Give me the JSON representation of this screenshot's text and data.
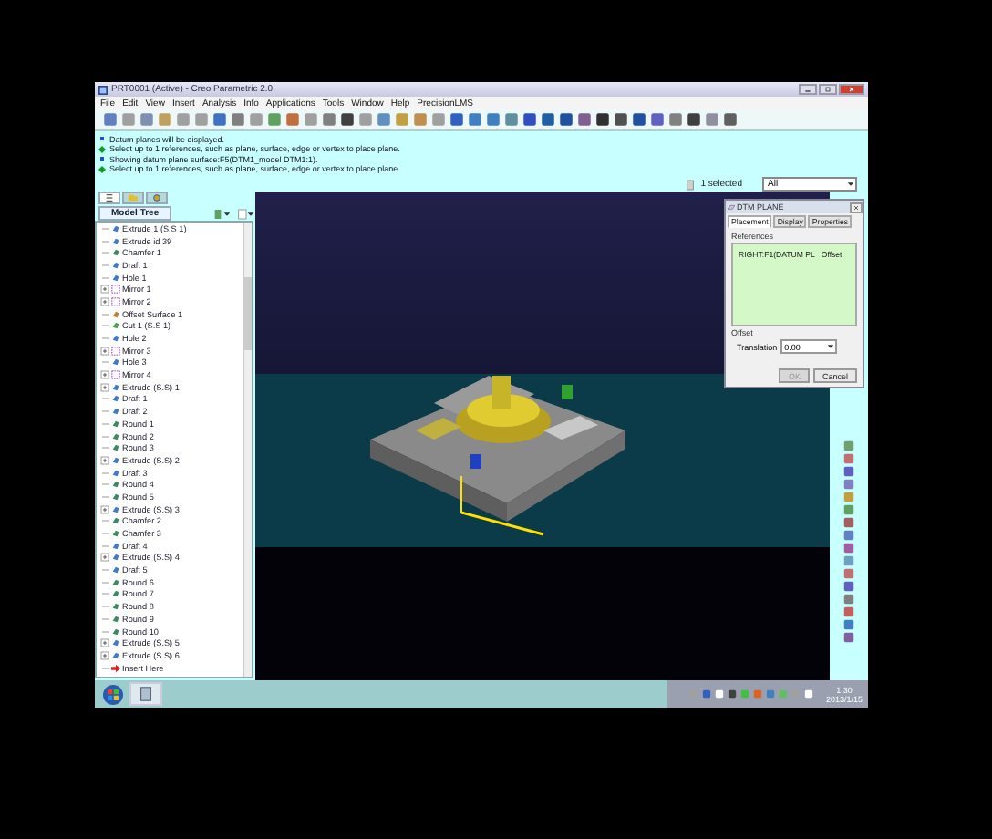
{
  "window": {
    "title": "PRT0001 (Active) - Creo Parametric 2.0"
  },
  "menu": [
    "File",
    "Edit",
    "View",
    "Insert",
    "Analysis",
    "Info",
    "Applications",
    "Tools",
    "Window",
    "Help",
    "PrecisionLMS"
  ],
  "messages": [
    {
      "kind": "info",
      "text": "Datum planes will be displayed."
    },
    {
      "kind": "prompt",
      "text": "Select up to 1 references, such as plane, surface, edge or vertex to place plane."
    },
    {
      "kind": "info",
      "text": "Showing datum plane surface:F5(DTM1_model DTM1:1)."
    },
    {
      "kind": "prompt",
      "text": "Select up to 1 references, such as plane, surface, edge or vertex to place plane."
    }
  ],
  "selection": {
    "count": "1 selected",
    "filter": "All"
  },
  "model_tree": {
    "tabs": [
      {
        "kind": "tree",
        "selected": true
      },
      {
        "kind": "folder",
        "selected": false
      },
      {
        "kind": "star",
        "selected": false
      }
    ],
    "title": "Model Tree",
    "items": [
      {
        "kind": "extrude",
        "label": "Extrude 1 (S.S 1)"
      },
      {
        "kind": "extrude",
        "label": "Extrude id 39"
      },
      {
        "kind": "round",
        "label": "Chamfer 1"
      },
      {
        "kind": "draft",
        "label": "Draft 1"
      },
      {
        "kind": "hole",
        "label": "Hole 1"
      },
      {
        "kind": "group",
        "label": "Mirror 1"
      },
      {
        "kind": "group",
        "label": "Mirror 2"
      },
      {
        "kind": "surface",
        "label": "Offset Surface 1"
      },
      {
        "kind": "cut",
        "label": "Cut 1 (S.S 1)"
      },
      {
        "kind": "hole",
        "label": "Hole 2"
      },
      {
        "kind": "group",
        "label": "Mirror 3"
      },
      {
        "kind": "hole",
        "label": "Hole 3"
      },
      {
        "kind": "group",
        "label": "Mirror 4"
      },
      {
        "kind": "extgroup",
        "label": "Extrude (S.S) 1"
      },
      {
        "kind": "draft",
        "label": "Draft 1"
      },
      {
        "kind": "draft",
        "label": "Draft 2"
      },
      {
        "kind": "round",
        "label": "Round 1"
      },
      {
        "kind": "round",
        "label": "Round 2"
      },
      {
        "kind": "round",
        "label": "Round 3"
      },
      {
        "kind": "extgroup",
        "label": "Extrude (S.S) 2"
      },
      {
        "kind": "draft",
        "label": "Draft 3"
      },
      {
        "kind": "round",
        "label": "Round 4"
      },
      {
        "kind": "round",
        "label": "Round 5"
      },
      {
        "kind": "extgroup",
        "label": "Extrude (S.S) 3"
      },
      {
        "kind": "round",
        "label": "Chamfer 2"
      },
      {
        "kind": "round",
        "label": "Chamfer 3"
      },
      {
        "kind": "draft",
        "label": "Draft 4"
      },
      {
        "kind": "extgroup",
        "label": "Extrude (S.S) 4"
      },
      {
        "kind": "draft",
        "label": "Draft 5"
      },
      {
        "kind": "round",
        "label": "Round 6"
      },
      {
        "kind": "round",
        "label": "Round 7"
      },
      {
        "kind": "round",
        "label": "Round 8"
      },
      {
        "kind": "round",
        "label": "Round 9"
      },
      {
        "kind": "round",
        "label": "Round 10"
      },
      {
        "kind": "extgroup",
        "label": "Extrude (S.S) 5"
      },
      {
        "kind": "extgroup",
        "label": "Extrude (S.S) 6"
      },
      {
        "kind": "insert",
        "label": "Insert Here"
      }
    ]
  },
  "dialog": {
    "title": "DTM PLANE",
    "tabs": [
      {
        "label": "Placement",
        "selected": true
      },
      {
        "label": "Display",
        "selected": false
      },
      {
        "label": "Properties",
        "selected": false
      }
    ],
    "section": "References",
    "references": [
      "RIGHT:F1(DATUM PL   Offset"
    ],
    "offset_label": "Offset",
    "offset_type": "Translation",
    "offset_value": "0.00",
    "buttons": [
      {
        "label": "OK",
        "disabled": true
      },
      {
        "label": "Cancel",
        "disabled": false
      }
    ]
  },
  "taskbar": {
    "time": "1:30",
    "date": "2013/1/15"
  }
}
